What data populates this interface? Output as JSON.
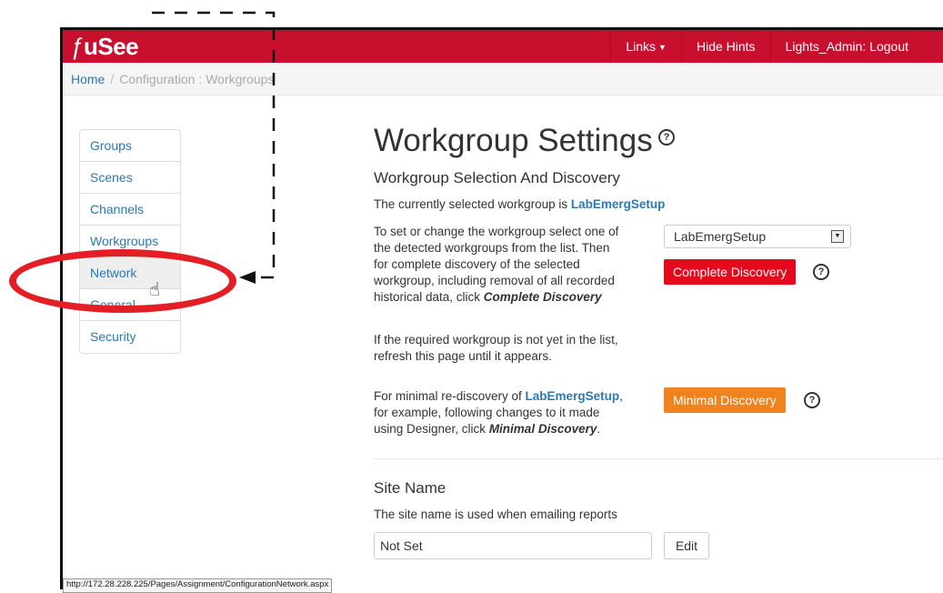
{
  "app": {
    "brand": "uSee",
    "brand_glyph": "ƒ"
  },
  "navbar": {
    "links_label": "Links",
    "hide_hints_label": "Hide Hints",
    "logout_label": "Lights_Admin: Logout"
  },
  "breadcrumb": {
    "home": "Home",
    "separator": "/",
    "current": "Configuration : Workgroups"
  },
  "sidebar": {
    "items": [
      {
        "label": "Groups"
      },
      {
        "label": "Scenes"
      },
      {
        "label": "Channels"
      },
      {
        "label": "Workgroups"
      },
      {
        "label": "Network"
      },
      {
        "label": "General"
      },
      {
        "label": "Security"
      }
    ],
    "hovered": "Network"
  },
  "main": {
    "title": "Workgroup Settings",
    "help_glyph": "?",
    "selection": {
      "heading": "Workgroup Selection And Discovery",
      "current_prefix": "The currently selected workgroup is ",
      "current_workgroup": "LabEmergSetup",
      "instructions_1": "To set or change the workgroup select one of",
      "instructions_2": "the detected workgroups from the list. Then",
      "instructions_3": "for complete discovery of the selected",
      "instructions_4": "workgroup, including removal of all recorded",
      "instructions_5_prefix": "historical data, click ",
      "instructions_5_em": "Complete Discovery",
      "dropdown_value": "LabEmergSetup",
      "complete_button": "Complete Discovery",
      "missing_1": "If the required workgroup is not yet in the list,",
      "missing_2": "refresh this page until it appears.",
      "minimal_1_prefix": "For minimal re-discovery of ",
      "minimal_1_workgroup": "LabEmergSetup",
      "minimal_1_suffix": ",",
      "minimal_2": "for example, following changes to it made",
      "minimal_3_prefix": "using Designer, click ",
      "minimal_3_em": "Minimal Discovery",
      "minimal_3_suffix": ".",
      "minimal_button": "Minimal Discovery"
    },
    "site_name": {
      "heading": "Site Name",
      "description": "The site name is used when emailing reports",
      "value": "Not Set",
      "edit_button": "Edit"
    }
  },
  "status_bar": {
    "url": "http://172.28.228.225/Pages/Assignment/ConfigurationNetwork.aspx"
  },
  "colors": {
    "navbar": "#c8102e",
    "link": "#2a78b5",
    "complete_button": "#e4091d",
    "minimal_button": "#f0831e",
    "annotation": "#e31e24"
  }
}
